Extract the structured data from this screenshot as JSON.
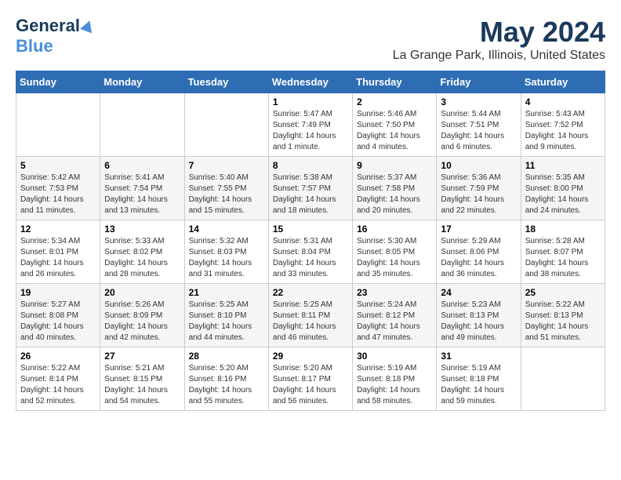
{
  "logo": {
    "line1": "General",
    "line2": "Blue"
  },
  "title": "May 2024",
  "location": "La Grange Park, Illinois, United States",
  "weekdays": [
    "Sunday",
    "Monday",
    "Tuesday",
    "Wednesday",
    "Thursday",
    "Friday",
    "Saturday"
  ],
  "weeks": [
    [
      {
        "day": "",
        "info": ""
      },
      {
        "day": "",
        "info": ""
      },
      {
        "day": "",
        "info": ""
      },
      {
        "day": "1",
        "info": "Sunrise: 5:47 AM\nSunset: 7:49 PM\nDaylight: 14 hours\nand 1 minute."
      },
      {
        "day": "2",
        "info": "Sunrise: 5:46 AM\nSunset: 7:50 PM\nDaylight: 14 hours\nand 4 minutes."
      },
      {
        "day": "3",
        "info": "Sunrise: 5:44 AM\nSunset: 7:51 PM\nDaylight: 14 hours\nand 6 minutes."
      },
      {
        "day": "4",
        "info": "Sunrise: 5:43 AM\nSunset: 7:52 PM\nDaylight: 14 hours\nand 9 minutes."
      }
    ],
    [
      {
        "day": "5",
        "info": "Sunrise: 5:42 AM\nSunset: 7:53 PM\nDaylight: 14 hours\nand 11 minutes."
      },
      {
        "day": "6",
        "info": "Sunrise: 5:41 AM\nSunset: 7:54 PM\nDaylight: 14 hours\nand 13 minutes."
      },
      {
        "day": "7",
        "info": "Sunrise: 5:40 AM\nSunset: 7:55 PM\nDaylight: 14 hours\nand 15 minutes."
      },
      {
        "day": "8",
        "info": "Sunrise: 5:38 AM\nSunset: 7:57 PM\nDaylight: 14 hours\nand 18 minutes."
      },
      {
        "day": "9",
        "info": "Sunrise: 5:37 AM\nSunset: 7:58 PM\nDaylight: 14 hours\nand 20 minutes."
      },
      {
        "day": "10",
        "info": "Sunrise: 5:36 AM\nSunset: 7:59 PM\nDaylight: 14 hours\nand 22 minutes."
      },
      {
        "day": "11",
        "info": "Sunrise: 5:35 AM\nSunset: 8:00 PM\nDaylight: 14 hours\nand 24 minutes."
      }
    ],
    [
      {
        "day": "12",
        "info": "Sunrise: 5:34 AM\nSunset: 8:01 PM\nDaylight: 14 hours\nand 26 minutes."
      },
      {
        "day": "13",
        "info": "Sunrise: 5:33 AM\nSunset: 8:02 PM\nDaylight: 14 hours\nand 28 minutes."
      },
      {
        "day": "14",
        "info": "Sunrise: 5:32 AM\nSunset: 8:03 PM\nDaylight: 14 hours\nand 31 minutes."
      },
      {
        "day": "15",
        "info": "Sunrise: 5:31 AM\nSunset: 8:04 PM\nDaylight: 14 hours\nand 33 minutes."
      },
      {
        "day": "16",
        "info": "Sunrise: 5:30 AM\nSunset: 8:05 PM\nDaylight: 14 hours\nand 35 minutes."
      },
      {
        "day": "17",
        "info": "Sunrise: 5:29 AM\nSunset: 8:06 PM\nDaylight: 14 hours\nand 36 minutes."
      },
      {
        "day": "18",
        "info": "Sunrise: 5:28 AM\nSunset: 8:07 PM\nDaylight: 14 hours\nand 38 minutes."
      }
    ],
    [
      {
        "day": "19",
        "info": "Sunrise: 5:27 AM\nSunset: 8:08 PM\nDaylight: 14 hours\nand 40 minutes."
      },
      {
        "day": "20",
        "info": "Sunrise: 5:26 AM\nSunset: 8:09 PM\nDaylight: 14 hours\nand 42 minutes."
      },
      {
        "day": "21",
        "info": "Sunrise: 5:25 AM\nSunset: 8:10 PM\nDaylight: 14 hours\nand 44 minutes."
      },
      {
        "day": "22",
        "info": "Sunrise: 5:25 AM\nSunset: 8:11 PM\nDaylight: 14 hours\nand 46 minutes."
      },
      {
        "day": "23",
        "info": "Sunrise: 5:24 AM\nSunset: 8:12 PM\nDaylight: 14 hours\nand 47 minutes."
      },
      {
        "day": "24",
        "info": "Sunrise: 5:23 AM\nSunset: 8:13 PM\nDaylight: 14 hours\nand 49 minutes."
      },
      {
        "day": "25",
        "info": "Sunrise: 5:22 AM\nSunset: 8:13 PM\nDaylight: 14 hours\nand 51 minutes."
      }
    ],
    [
      {
        "day": "26",
        "info": "Sunrise: 5:22 AM\nSunset: 8:14 PM\nDaylight: 14 hours\nand 52 minutes."
      },
      {
        "day": "27",
        "info": "Sunrise: 5:21 AM\nSunset: 8:15 PM\nDaylight: 14 hours\nand 54 minutes."
      },
      {
        "day": "28",
        "info": "Sunrise: 5:20 AM\nSunset: 8:16 PM\nDaylight: 14 hours\nand 55 minutes."
      },
      {
        "day": "29",
        "info": "Sunrise: 5:20 AM\nSunset: 8:17 PM\nDaylight: 14 hours\nand 56 minutes."
      },
      {
        "day": "30",
        "info": "Sunrise: 5:19 AM\nSunset: 8:18 PM\nDaylight: 14 hours\nand 58 minutes."
      },
      {
        "day": "31",
        "info": "Sunrise: 5:19 AM\nSunset: 8:18 PM\nDaylight: 14 hours\nand 59 minutes."
      },
      {
        "day": "",
        "info": ""
      }
    ]
  ]
}
